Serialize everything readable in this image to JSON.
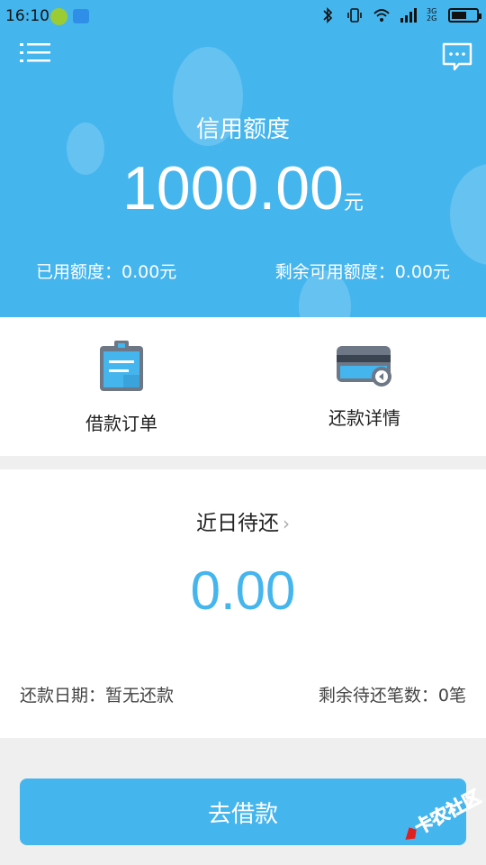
{
  "status_bar": {
    "time": "16:10",
    "net_labels": "3G 2G"
  },
  "header": {
    "credit_title": "信用额度",
    "credit_amount": "1000.00",
    "credit_unit": "元",
    "used_label": "已用额度：0.00元",
    "remaining_label": "剩余可用额度：0.00元"
  },
  "menu": {
    "orders_label": "借款订单",
    "repay_details_label": "还款详情"
  },
  "pending": {
    "title": "近日待还",
    "chevron": "›",
    "amount": "0.00",
    "repay_date": "还款日期：暂无还款",
    "remaining_count": "剩余待还笔数：0笔"
  },
  "actions": {
    "borrow_label": "去借款"
  },
  "watermark": {
    "text": "卡农社区"
  },
  "colors": {
    "primary": "#45b5ee",
    "background": "#efefef",
    "panel": "#ffffff"
  }
}
